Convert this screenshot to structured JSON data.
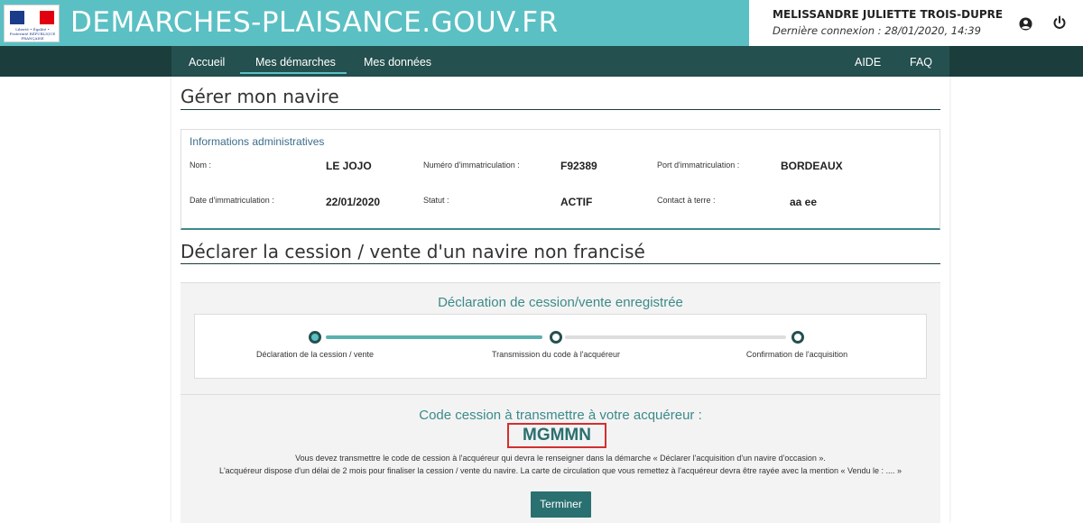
{
  "header": {
    "logo_text": "Liberté • Égalité • Fraternité RÉPUBLIQUE FRANÇAISE",
    "site_title": "DEMARCHES-PLAISANCE.GOUV.FR",
    "user_name": "MELISSANDRE JULIETTE TROIS-DUPRE",
    "last_login": "Dernière connexion : 28/01/2020, 14:39"
  },
  "nav": {
    "items": [
      "Accueil",
      "Mes démarches",
      "Mes données"
    ],
    "right_items": [
      "AIDE",
      "FAQ"
    ],
    "active": "Mes démarches"
  },
  "manage": {
    "title": "Gérer mon navire",
    "admin_title": "Informations administratives",
    "fields": [
      {
        "label": "Nom :",
        "value": "LE JOJO"
      },
      {
        "label": "Numéro d'immatriculation :",
        "value": "F92389"
      },
      {
        "label": "Port d'immatriculation :",
        "value": "BORDEAUX"
      },
      {
        "label": "Date d'immatriculation :",
        "value": "22/01/2020"
      },
      {
        "label": "Statut :",
        "value": "ACTIF"
      },
      {
        "label": "Contact à terre :",
        "value": "aa ee"
      }
    ]
  },
  "declare": {
    "title": "Déclarer la cession / vente d'un navire non francisé",
    "panel_title": "Déclaration de cession/vente enregistrée",
    "steps": [
      {
        "label": "Déclaration de la cession / vente",
        "state": "done"
      },
      {
        "label": "Transmission du code à l'acquéreur",
        "state": "current"
      },
      {
        "label": "Confirmation de l'acquisition",
        "state": "todo"
      }
    ],
    "code_title": "Code cession à transmettre à votre acquéreur :",
    "code": "MGMMN",
    "info_1": "Vous devez transmettre le code de cession à l'acquéreur qui devra le renseigner dans la démarche « Déclarer l'acquisition d'un navire d'occasion ».",
    "info_2": "L'acquéreur dispose d'un délai de 2 mois pour finaliser la cession / vente du navire. La carte de circulation que vous remettez à l'acquéreur devra être rayée avec la mention « Vendu le : .... »",
    "button_label": "Terminer"
  },
  "colors": {
    "header": "#5bc0c4",
    "nav": "#1b3d3c",
    "accent": "#3c8a8a",
    "code_border": "#d32f2f"
  }
}
